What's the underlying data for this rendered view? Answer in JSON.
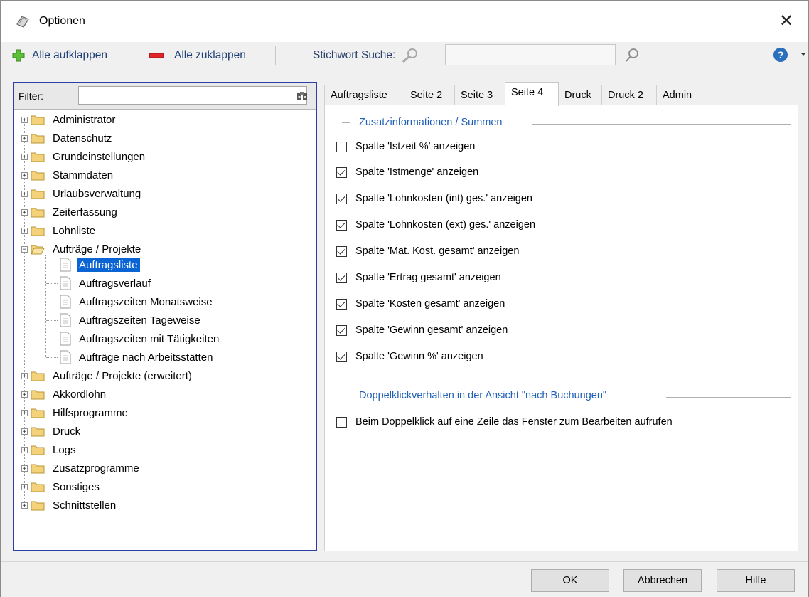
{
  "window": {
    "title": "Optionen"
  },
  "toolbar": {
    "expand_all": "Alle aufklappen",
    "collapse_all": "Alle zuklappen",
    "search_label": "Stichwort Suche:",
    "search_value": ""
  },
  "filter": {
    "label": "Filter:",
    "value": ""
  },
  "tree": {
    "top": [
      "Administrator",
      "Datenschutz",
      "Grundeinstellungen",
      "Stammdaten",
      "Urlaubsverwaltung",
      "Zeiterfassung",
      "Lohnliste"
    ],
    "open_folder": "Aufträge / Projekte",
    "children": [
      "Auftragsliste",
      "Auftragsverlauf",
      "Auftragszeiten Monatsweise",
      "Auftragszeiten Tageweise",
      "Auftragszeiten mit Tätigkeiten",
      "Aufträge nach Arbeitsstätten"
    ],
    "selected_child": "Auftragsliste",
    "bottom": [
      "Aufträge / Projekte (erweitert)",
      "Akkordlohn",
      "Hilfsprogramme",
      "Druck",
      "Logs",
      "Zusatzprogramme",
      "Sonstiges",
      "Schnittstellen"
    ]
  },
  "tabs": [
    "Auftragsliste",
    "Seite 2",
    "Seite 3",
    "Seite 4",
    "Druck",
    "Druck 2",
    "Admin"
  ],
  "active_tab": "Seite 4",
  "group1": {
    "title": "Zusatzinformationen / Summen",
    "items": [
      {
        "label": "Spalte 'Istzeit %' anzeigen",
        "checked": false
      },
      {
        "label": "Spalte 'Istmenge' anzeigen",
        "checked": true
      },
      {
        "label": "Spalte 'Lohnkosten (int) ges.' anzeigen",
        "checked": true
      },
      {
        "label": "Spalte 'Lohnkosten (ext) ges.' anzeigen",
        "checked": true
      },
      {
        "label": "Spalte 'Mat. Kost. gesamt' anzeigen",
        "checked": true
      },
      {
        "label": "Spalte 'Ertrag gesamt' anzeigen",
        "checked": true
      },
      {
        "label": "Spalte 'Kosten gesamt' anzeigen",
        "checked": true
      },
      {
        "label": "Spalte 'Gewinn gesamt' anzeigen",
        "checked": true
      },
      {
        "label": "Spalte 'Gewinn %' anzeigen",
        "checked": true
      }
    ]
  },
  "group2": {
    "title": "Doppelklickverhalten in der Ansicht \"nach Buchungen\"",
    "items": [
      {
        "label": "Beim Doppelklick auf eine Zeile das Fenster zum Bearbeiten aufrufen",
        "checked": false
      }
    ]
  },
  "buttons": {
    "ok": "OK",
    "cancel": "Abbrechen",
    "help": "Hilfe"
  },
  "colors": {
    "selection": "#0a64d4",
    "group_title": "#1f5fb4",
    "panel_border": "#2b3fa6"
  }
}
